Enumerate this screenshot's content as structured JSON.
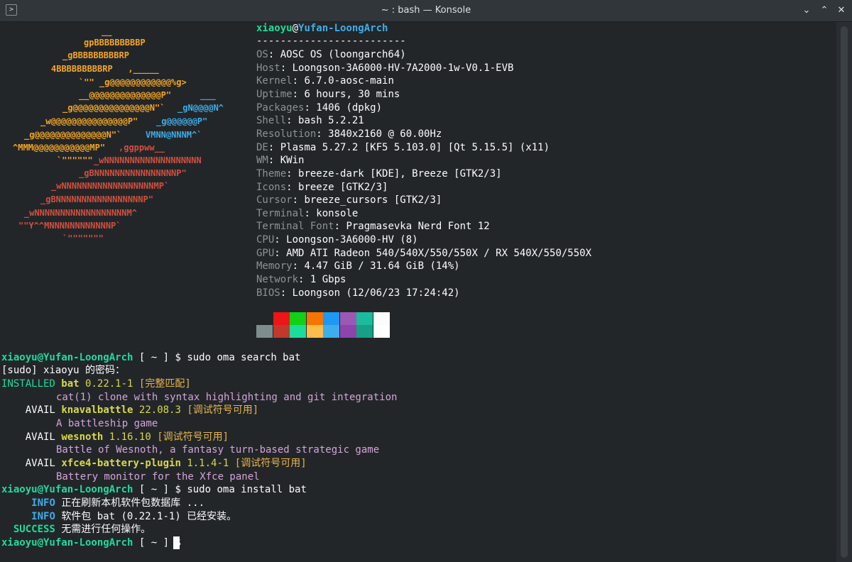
{
  "window": {
    "title": "~ : bash — Konsole",
    "app_icon": "terminal-icon",
    "controls": [
      "chevron-down-icon",
      "chevron-up-icon",
      "close-icon"
    ]
  },
  "logo": {
    "lines": [
      {
        "t": "__"
      },
      {
        "t": "gpBBBBBBBBBP"
      },
      {
        "t": "_gBBBBBBBBBRP"
      },
      {
        "t": "4BBBBBBBBBRP   ,_____"
      },
      {
        "t": "`\"\" _g@@@@@@@@@@@@%g>"
      },
      {
        "t": "__@@@@@@@@@@@@@@P\""
      },
      {
        "t": "_g@@@@@@@@@@@@@@@N\"`"
      },
      {
        "t": "_w@@@@@@@@@@@@@@@P\""
      },
      {
        "t": "_g@@@@@@@@@@@@@@N\"`"
      },
      {
        "t": "^MMM@@@@@@@@@@@MP\""
      },
      {
        "t": "`\"\"\"\"\"\""
      },
      {
        "t": "_gBNNNNNNNNNNNNNNNNP\""
      },
      {
        "t": "_wNNNNNNNNNNNNNNNNNNMP`"
      },
      {
        "t": "_gBNNNNNNNNNNNNNNNNNP\""
      },
      {
        "t": "_wNNNNNNNNNNNNNNNNNNM^"
      },
      {
        "t": "\"\"Y^^MNNNNNNNNNNNNP`"
      },
      {
        "t": "`\"\"\"\"\"\"\""
      }
    ],
    "blue_parts": [
      "___",
      "_gN@@@@N^",
      "_g@@@@@@P\"",
      "VMNN@NNNM^`"
    ],
    "red_parts": [
      ",ggppww__",
      "_wNNNNNNNNNNNNNNNNNNN"
    ]
  },
  "sysinfo": {
    "user": "xiaoyu",
    "at": "@",
    "host": "Yufan-LoongArch",
    "separator": "-------------------------",
    "rows": [
      {
        "label": "OS",
        "value": "AOSC OS (loongarch64)"
      },
      {
        "label": "Host",
        "value": "Loongson-3A6000-HV-7A2000-1w-V0.1-EVB"
      },
      {
        "label": "Kernel",
        "value": "6.7.0-aosc-main"
      },
      {
        "label": "Uptime",
        "value": "6 hours, 30 mins"
      },
      {
        "label": "Packages",
        "value": "1406 (dpkg)"
      },
      {
        "label": "Shell",
        "value": "bash 5.2.21"
      },
      {
        "label": "Resolution",
        "value": "3840x2160 @ 60.00Hz"
      },
      {
        "label": "DE",
        "value": "Plasma 5.27.2 [KF5 5.103.0] [Qt 5.15.5] (x11)"
      },
      {
        "label": "WM",
        "value": "KWin"
      },
      {
        "label": "Theme",
        "value": "breeze-dark [KDE], Breeze [GTK2/3]"
      },
      {
        "label": "Icons",
        "value": "breeze [GTK2/3]"
      },
      {
        "label": "Cursor",
        "value": "breeze_cursors [GTK2/3]"
      },
      {
        "label": "Terminal",
        "value": "konsole"
      },
      {
        "label": "Terminal Font",
        "value": "Pragmasevka Nerd Font 12"
      },
      {
        "label": "CPU",
        "value": "Loongson-3A6000-HV (8)"
      },
      {
        "label": "GPU",
        "value": "AMD ATI Radeon 540/540X/550/550X / RX 540X/550/550X"
      },
      {
        "label": "Memory",
        "value": "4.47 GiB / 31.64 GiB (14%)"
      },
      {
        "label": "Network",
        "value": "1 Gbps"
      },
      {
        "label": "BIOS",
        "value": "Loongson (12/06/23 17:24:42)"
      }
    ],
    "palette_top": [
      "#232629",
      "#ed1515",
      "#11d116",
      "#f67400",
      "#1d99f3",
      "#9b59b6",
      "#1abc9c",
      "#fcfcfc"
    ],
    "palette_bottom": [
      "#7f8c8d",
      "#c0392b",
      "#1cdc9a",
      "#fdbc4b",
      "#3daee9",
      "#8e44ad",
      "#16a085",
      "#ffffff"
    ]
  },
  "session": {
    "prompt_user_host": "xiaoyu@Yufan-LoongArch",
    "prompt_dir": " [ ~ ] ",
    "prompt_sym": "$",
    "cmd1": " sudo oma search bat",
    "sudo_prompt": "[sudo] xiaoyu 的密码：",
    "results": [
      {
        "status": "INSTALLED",
        "name": "bat",
        "version": "0.22.1-1",
        "tag": "[完整匹配]",
        "desc": "cat(1) clone with syntax highlighting and git integration"
      },
      {
        "status": "AVAIL",
        "name": "knavalbattle",
        "version": "22.08.3",
        "tag": "[调试符号可用]",
        "desc": "A battleship game"
      },
      {
        "status": "AVAIL",
        "name": "wesnoth",
        "version": "1.16.10",
        "tag": "[调试符号可用]",
        "desc": "Battle of Wesnoth, a fantasy turn-based strategic game"
      },
      {
        "status": "AVAIL",
        "name": "xfce4-battery-plugin",
        "version": "1.1.4-1",
        "tag": "[调试符号可用]",
        "desc": "Battery monitor for the Xfce panel"
      }
    ],
    "cmd2": " sudo oma install bat",
    "log": [
      {
        "level": "INFO",
        "msg": "正在刷新本机软件包数据库 ..."
      },
      {
        "level": "INFO",
        "msg": "软件包 bat (0.22.1-1) 已经安装。"
      },
      {
        "level": "SUCCESS",
        "msg": "无需进行任何操作。"
      }
    ]
  }
}
